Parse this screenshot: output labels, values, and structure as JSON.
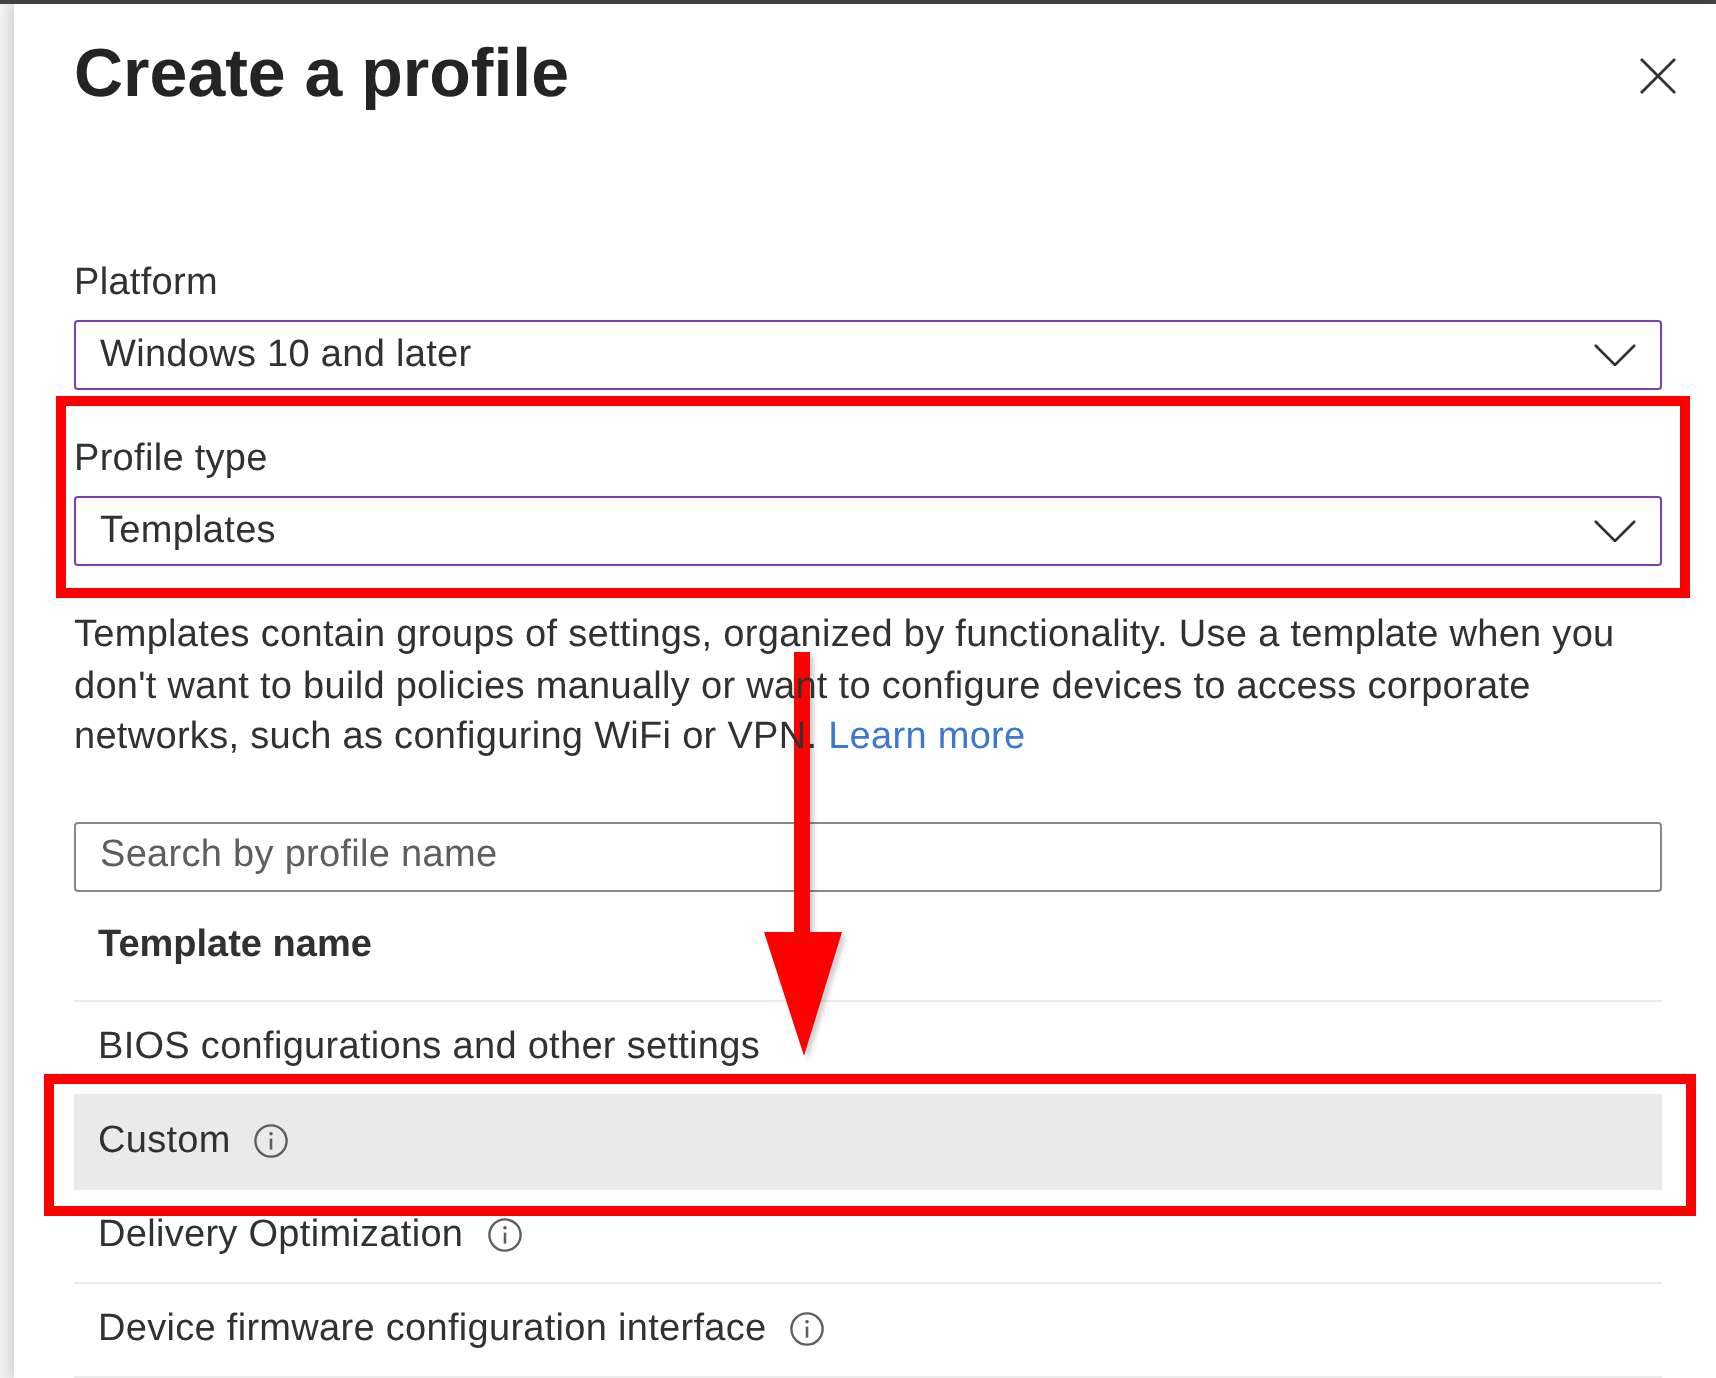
{
  "panel": {
    "title": "Create a profile"
  },
  "platform": {
    "label": "Platform",
    "value": "Windows 10 and later"
  },
  "profile_type": {
    "label": "Profile type",
    "value": "Templates",
    "highlighted": true
  },
  "description": {
    "text": "Templates contain groups of settings, organized by functionality. Use a template when you don't want to build policies manually or want to configure devices to access corporate networks, such as configuring WiFi or VPN.",
    "link": "Learn more"
  },
  "search": {
    "placeholder": "Search by profile name"
  },
  "table": {
    "columns": [
      "Template name"
    ],
    "rows": [
      {
        "name": "BIOS configurations and other settings",
        "info": false,
        "selected": false,
        "highlighted": false
      },
      {
        "name": "Custom",
        "info": true,
        "selected": true,
        "highlighted": true
      },
      {
        "name": "Delivery Optimization",
        "info": true,
        "selected": false,
        "highlighted": false
      },
      {
        "name": "Device firmware configuration interface",
        "info": true,
        "selected": false,
        "highlighted": false
      }
    ]
  },
  "annotation_arrow": true
}
